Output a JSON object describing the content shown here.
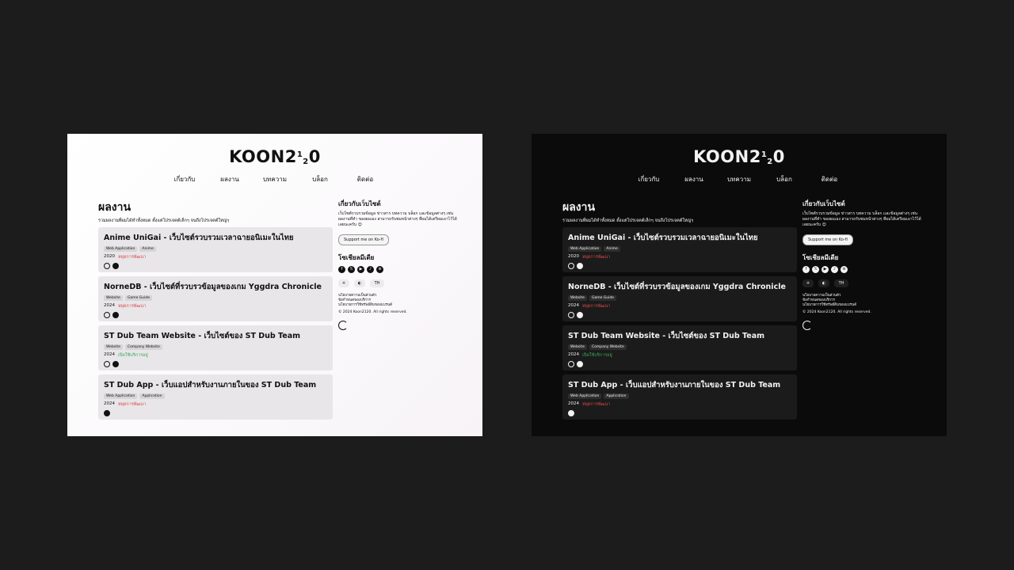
{
  "logo": {
    "main": "KOON2",
    "sup": "1",
    "sub": "2",
    "end": "0"
  },
  "nav": [
    "เกี่ยวกับ",
    "ผลงาน",
    "บทความ",
    "บล็อก",
    "ติดต่อ"
  ],
  "main": {
    "title": "ผลงาน",
    "description": "รวมผลงานที่ผมได้ทำทั้งหมด ตั้งแต่โปรเจคต์เล็กๆ จนถึงโปรเจคต์ใหญ่ๆ"
  },
  "projects": [
    {
      "title": "Anime UniGai - เว็บไซต์รวบรวมเวลาฉายอนิเมะในไทย",
      "tags": [
        "Web Application",
        "Anime"
      ],
      "year": "2020",
      "status": "หยุดการพัฒนา",
      "status_type": "dev"
    },
    {
      "title": "NorneDB - เว็บไซต์ที่รวบรวข้อมูลของเกม Yggdra Chronicle",
      "tags": [
        "Website",
        "Game Guide"
      ],
      "year": "2024",
      "status": "หยุดการพัฒนา",
      "status_type": "dev"
    },
    {
      "title": "ST Dub Team Website - เว็บไซต์ของ ST Dub Team",
      "tags": [
        "Website",
        "Company Website"
      ],
      "year": "2024",
      "status": "เปิดใช้บริการอยู่",
      "status_type": "live"
    },
    {
      "title": "ST Dub App - เว็บแอปสำหรับงานภายในของ ST Dub Team",
      "tags": [
        "Web Application",
        "Application"
      ],
      "year": "2024",
      "status": "หยุดการพัฒนา",
      "status_type": "dev"
    }
  ],
  "sidebar": {
    "about_title": "เกี่ยวกับเว็บไซต์",
    "about_desc": "เว็บไซต์รวบรวมข้อมูล ข่าวสาร บทความ บล็อก และข้อมูลต่างๆ เช่น ผลงานที่ทำ ของผมเอง สามารถรับชมหน้าต่างๆ ที่ผมได้เตรียมเอาไว้ได้เลยนะครับ 😊",
    "kofi": "Support me on Ko-fi",
    "social_title": "โซเชียลมีเดีย",
    "socials": [
      "f",
      "𝕏",
      "▶",
      "♪",
      "⊚"
    ],
    "theme_icons": [
      "☀",
      "◐"
    ],
    "lang": "TH"
  },
  "footer": {
    "links": [
      "นโยบายความเป็นส่วนตัว",
      "ข้อกำหนดของบริการ",
      "นโยบายการใช้ทรัพย์สินของแบรนด์"
    ],
    "copyright": "© 2024 Koon2120. All rights reserved."
  }
}
